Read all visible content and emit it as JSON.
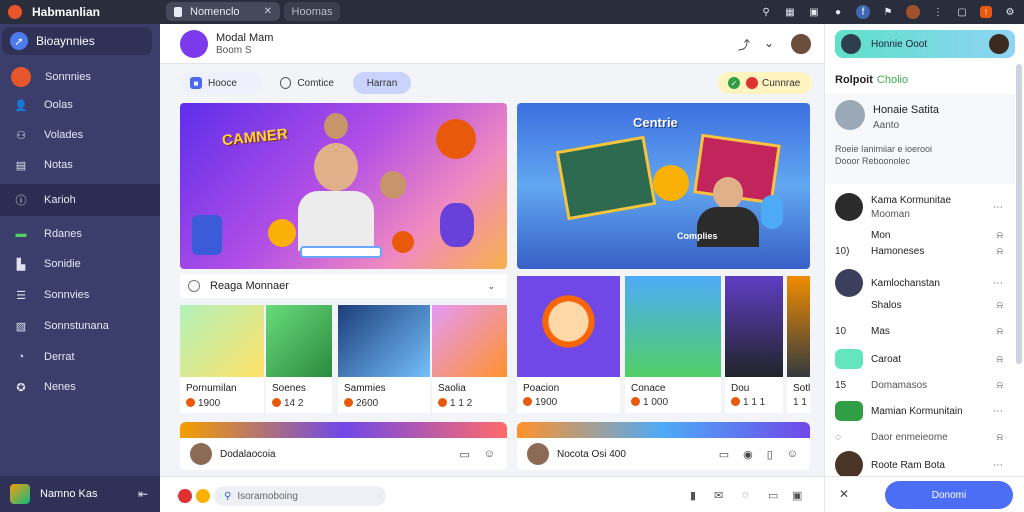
{
  "app": {
    "title": "Habmanlian"
  },
  "tabs": {
    "active_label": "Nomenclo",
    "second_label": "Hoomas"
  },
  "sidebar": {
    "header_label": "Bioaynnies",
    "items": [
      {
        "label": "Sonnnies"
      },
      {
        "label": "Oolas"
      },
      {
        "label": "Volades"
      },
      {
        "label": "Notas"
      },
      {
        "label": "Karioh"
      },
      {
        "label": "Rdanes"
      },
      {
        "label": "Sonidie"
      },
      {
        "label": "Sonnvies"
      },
      {
        "label": "Sonnstunana"
      },
      {
        "label": "Derrat"
      },
      {
        "label": "Nenes"
      }
    ],
    "footer_label": "Namno Kas"
  },
  "main": {
    "header": {
      "title": "Modal Mam",
      "subtitle": "Boom S"
    },
    "filters": {
      "chip_a": "Hooce",
      "chip_b": "Comtice",
      "chip_c": "Harran",
      "chip_d": "Cunnrae"
    },
    "hero1": {
      "title": "CAMNER"
    },
    "hero2": {
      "title": "Centrie",
      "subtitle": "Complies"
    },
    "section": {
      "title": "Reaga Monnaer"
    },
    "cards": [
      {
        "name": "Pornumilan",
        "meta": "1900"
      },
      {
        "name": "Soenes",
        "meta": "14 2"
      },
      {
        "name": "Sammies",
        "meta": "2600"
      },
      {
        "name": "Saolia",
        "meta": "1 1 2"
      },
      {
        "name": "Poacion",
        "meta": "1900"
      },
      {
        "name": "Conace",
        "meta": "1 000"
      },
      {
        "name": "Dou",
        "meta": "1 1 1"
      },
      {
        "name": "Sotlou",
        "meta": "1 1"
      }
    ],
    "bottom_cards": [
      {
        "label": "Dodalaocoia"
      },
      {
        "label": "Nocota Osi 400"
      }
    ],
    "composer": {
      "search_placeholder": "Isoramoboing"
    }
  },
  "right": {
    "top_label": "Honnie Ooot",
    "subheader": {
      "bold": "Rolpoit",
      "green": "Cholio"
    },
    "profile": {
      "name": "Honaie Satita",
      "status": "Aanto",
      "desc1": "Roeie Ianimiiar e ioerooi",
      "desc2": "Dooor Reboonolec"
    },
    "items": [
      {
        "label": "Kama Kormunitae",
        "sub": "Mooman"
      },
      {
        "label": "Mon",
        "sub": ""
      },
      {
        "label": "Hamoneses",
        "sub": ""
      },
      {
        "label": "Kamlochanstan",
        "sub": ""
      },
      {
        "label": "Shalos",
        "sub": ""
      },
      {
        "label": "Mas",
        "sub": ""
      },
      {
        "label": "Caroat",
        "sub": ""
      },
      {
        "label": "Domamasos",
        "sub": ""
      },
      {
        "label": "Mamian Kormunitain",
        "sub": ""
      },
      {
        "label": "Daor enmeieome",
        "sub": ""
      },
      {
        "label": "Roote Ram Bota",
        "sub": ""
      }
    ],
    "numbers": {
      "n1": "10)",
      "n2": "10",
      "n3": "15"
    },
    "footer": {
      "button_label": "Donomi"
    }
  },
  "colors": {
    "sidebar": "#3b3e6b",
    "accent": "#4c6ef5",
    "topbar": "#2a2d3c"
  }
}
